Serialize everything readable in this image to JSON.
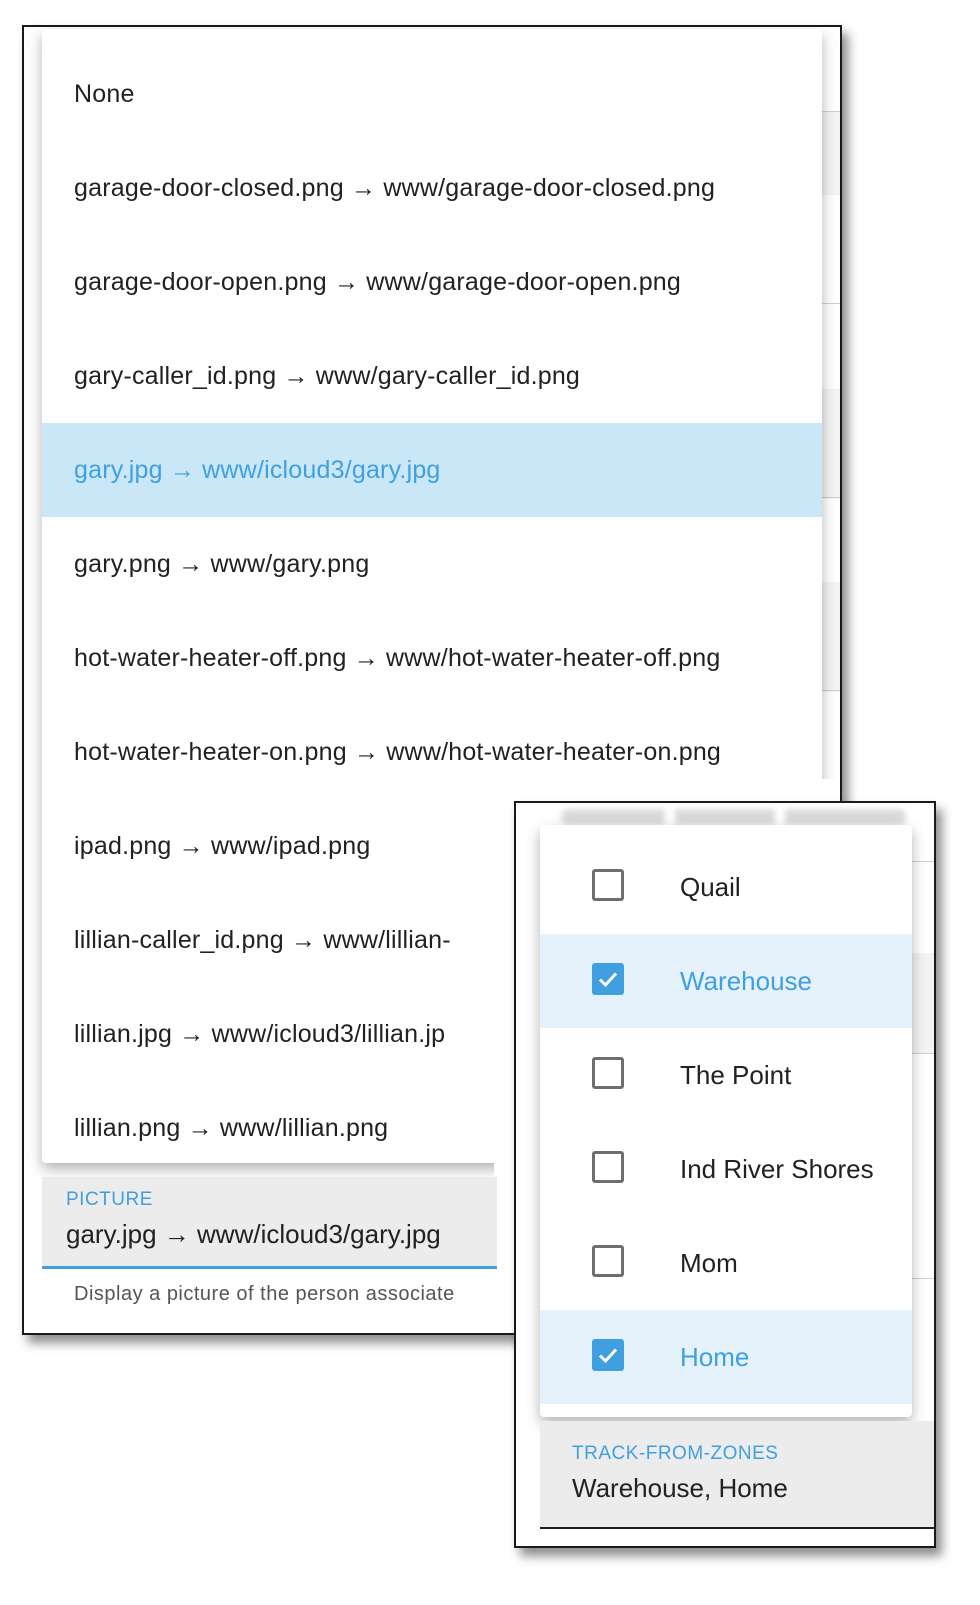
{
  "picture_menu": {
    "items": [
      {
        "label": "None",
        "selected": false
      },
      {
        "label": "garage-door-closed.png → www/garage-door-closed.png",
        "selected": false
      },
      {
        "label": "garage-door-open.png → www/garage-door-open.png",
        "selected": false
      },
      {
        "label": "gary-caller_id.png → www/gary-caller_id.png",
        "selected": false
      },
      {
        "label": "gary.jpg → www/icloud3/gary.jpg",
        "selected": true
      },
      {
        "label": "gary.png → www/gary.png",
        "selected": false
      },
      {
        "label": "hot-water-heater-off.png → www/hot-water-heater-off.png",
        "selected": false
      },
      {
        "label": "hot-water-heater-on.png → www/hot-water-heater-on.png",
        "selected": false
      },
      {
        "label": "ipad.png → www/ipad.png",
        "selected": false
      },
      {
        "label": "lillian-caller_id.png → www/lillian-",
        "selected": false
      },
      {
        "label": "lillian.jpg → www/icloud3/lillian.jp",
        "selected": false
      },
      {
        "label": "lillian.png → www/lillian.png",
        "selected": false
      }
    ]
  },
  "picture_field": {
    "label": "PICTURE",
    "value": "gary.jpg → www/icloud3/gary.jpg",
    "helper": "Display a picture of the person associate"
  },
  "zones_menu": {
    "items": [
      {
        "label": "Quail",
        "checked": false
      },
      {
        "label": "Warehouse",
        "checked": true
      },
      {
        "label": "The Point",
        "checked": false
      },
      {
        "label": "Ind River Shores",
        "checked": false
      },
      {
        "label": "Mom",
        "checked": false
      },
      {
        "label": "Home",
        "checked": true
      }
    ]
  },
  "zones_field": {
    "label": "TRACK-FROM-ZONES",
    "value": "Warehouse, Home"
  },
  "colors": {
    "accent": "#3f9fe0",
    "selected_row": "#cae7f8",
    "selected_row_light": "#e5f2fb",
    "field_background": "#ececec"
  }
}
